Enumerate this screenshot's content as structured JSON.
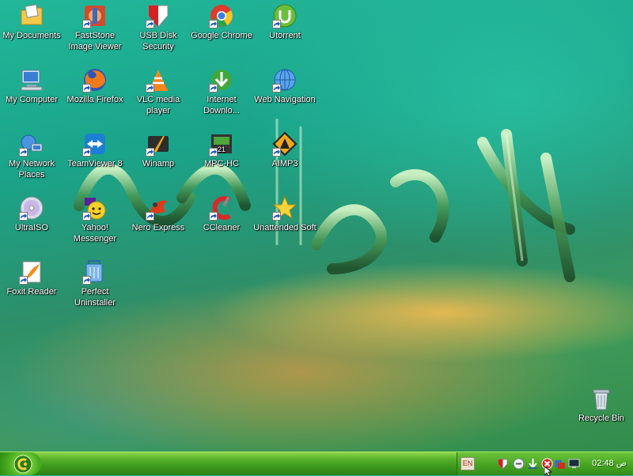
{
  "desktop": {
    "icons": [
      {
        "label": "My Documents",
        "icon": "folder-documents-icon"
      },
      {
        "label": "FastStone Image Viewer",
        "icon": "faststone-icon"
      },
      {
        "label": "USB Disk Security",
        "icon": "usb-security-icon"
      },
      {
        "label": "Google Chrome",
        "icon": "chrome-icon"
      },
      {
        "label": "Utorrent",
        "icon": "utorrent-icon"
      },
      {
        "label": "My Computer",
        "icon": "computer-icon"
      },
      {
        "label": "Mozilla Firefox",
        "icon": "firefox-icon"
      },
      {
        "label": "VLC media player",
        "icon": "vlc-icon"
      },
      {
        "label": "Internet Downlo...",
        "icon": "idm-icon"
      },
      {
        "label": "Web Navigation",
        "icon": "globe-icon"
      },
      {
        "label": "My Network Places",
        "icon": "network-icon"
      },
      {
        "label": "TeamViewer 8",
        "icon": "teamviewer-icon"
      },
      {
        "label": "Winamp",
        "icon": "winamp-icon"
      },
      {
        "label": "MPC-HC",
        "icon": "mpc-icon"
      },
      {
        "label": "AIMP3",
        "icon": "aimp-icon"
      },
      {
        "label": "UltraISO",
        "icon": "disc-icon"
      },
      {
        "label": "Yahoo! Messenger",
        "icon": "yahoo-icon"
      },
      {
        "label": "Nero Express",
        "icon": "nero-icon"
      },
      {
        "label": "CCleaner",
        "icon": "ccleaner-icon"
      },
      {
        "label": "Unattended Soft",
        "icon": "star-icon"
      },
      {
        "label": "Foxit Reader",
        "icon": "foxit-icon"
      },
      {
        "label": "Perfect Uninstaller",
        "icon": "uninstaller-icon"
      }
    ],
    "recycle_bin": {
      "label": "Recycle Bin",
      "icon": "recycle-bin-icon"
    }
  },
  "taskbar": {
    "start_icon": "start-orb-icon",
    "tray": {
      "language": "EN",
      "icons": [
        "usb-guard-icon",
        "minus-circle-icon",
        "download-arrow-icon",
        "red-x-icon",
        "security-shield-icon",
        "network-monitor-icon"
      ],
      "clock": "02:48 ص"
    }
  },
  "colors": {
    "taskbar_green": "#3d9a1e",
    "desktop_teal": "#1aa48a"
  }
}
